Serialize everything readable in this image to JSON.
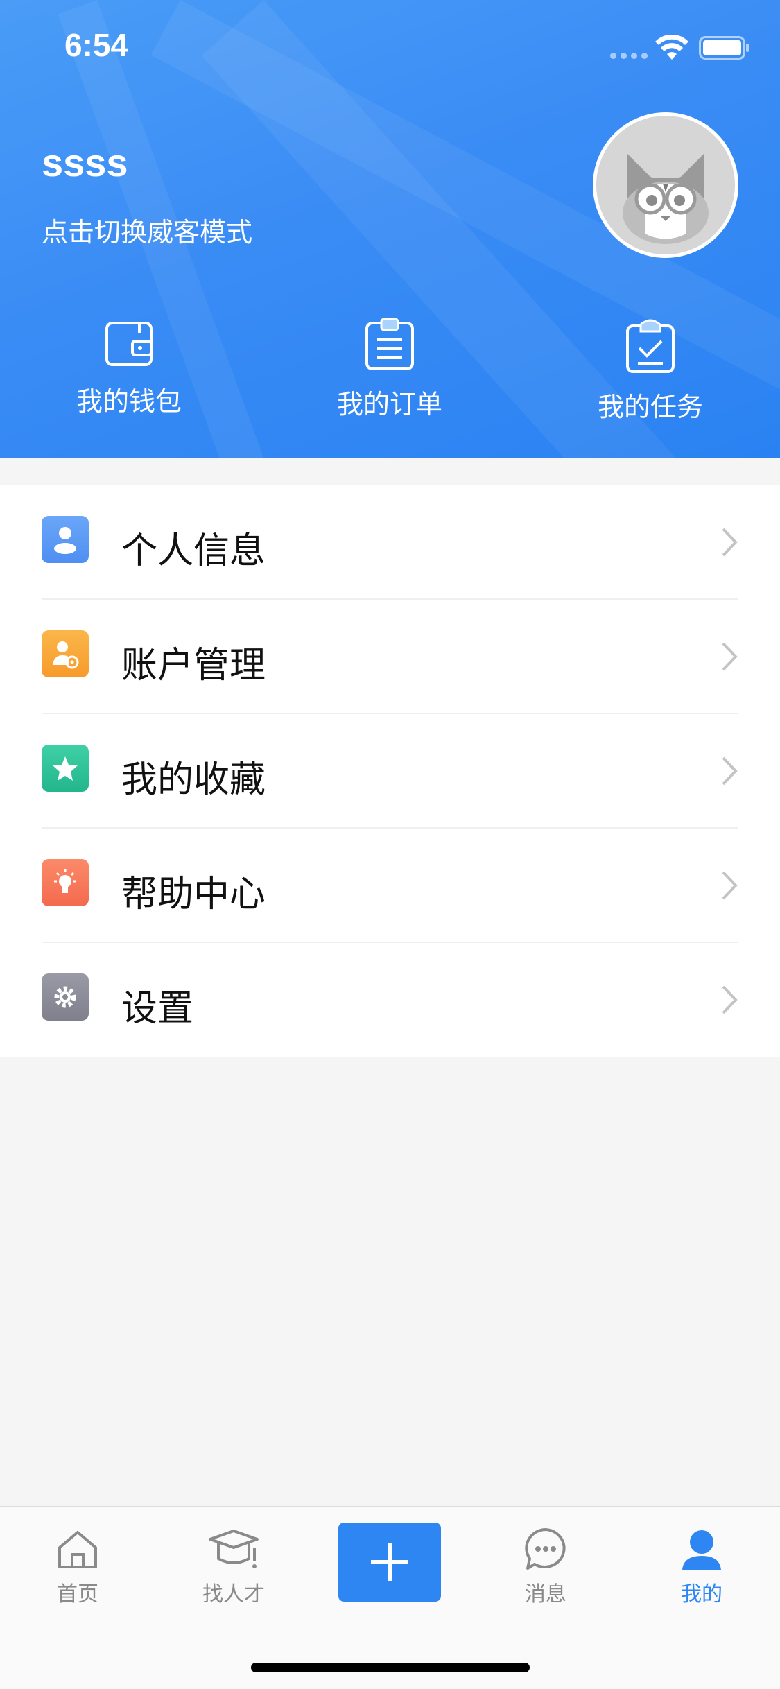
{
  "status_bar": {
    "time": "6:54"
  },
  "profile": {
    "username": "ssss",
    "switch_mode_text": "点击切换威客模式"
  },
  "quick_actions": [
    {
      "label": "我的钱包",
      "icon": "wallet-icon"
    },
    {
      "label": "我的订单",
      "icon": "order-clipboard-icon"
    },
    {
      "label": "我的任务",
      "icon": "task-clipboard-icon"
    }
  ],
  "menu": [
    {
      "label": "个人信息",
      "icon": "person-icon",
      "color": "#5b9cf5"
    },
    {
      "label": "账户管理",
      "icon": "account-gear-icon",
      "color": "#f9a93a"
    },
    {
      "label": "我的收藏",
      "icon": "star-icon",
      "color": "#2ec39a"
    },
    {
      "label": "帮助中心",
      "icon": "lightbulb-icon",
      "color": "#f97a5e"
    },
    {
      "label": "设置",
      "icon": "gear-icon",
      "color": "#8f8f9a"
    }
  ],
  "tabbar": {
    "home": "首页",
    "talent": "找人才",
    "messages": "消息",
    "mine": "我的",
    "active_color": "#2e86f3"
  }
}
